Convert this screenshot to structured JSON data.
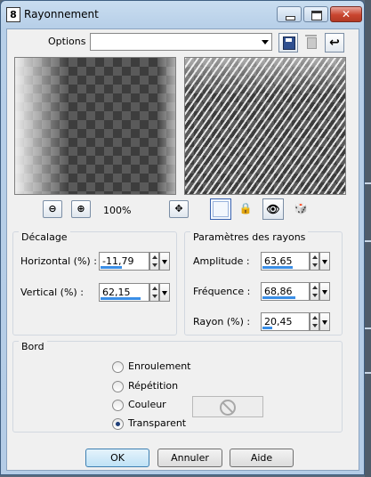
{
  "window": {
    "icon_text": "8",
    "title": "Rayonnement",
    "close_glyph": "✕"
  },
  "options": {
    "label": "Options :",
    "value": ""
  },
  "toolbar": {
    "reset_glyph": "↩"
  },
  "zoom": {
    "level": "100%",
    "out_glyph": "⊖",
    "in_glyph": "⊕",
    "pan_glyph": "✥"
  },
  "view_buttons": {
    "lock_glyph": "🔒",
    "eye_glyph": "👁",
    "random_glyph": "🎲"
  },
  "offset_group": {
    "title": "Décalage",
    "horizontal": {
      "label": "Horizontal (%) :",
      "value": "-11,79",
      "fill": 0.44
    },
    "vertical": {
      "label": "Vertical (%) :",
      "value": "62,15",
      "fill": 0.81
    }
  },
  "params_group": {
    "title": "Paramètres des rayons",
    "amplitude": {
      "label": "Amplitude :",
      "value": "63,65",
      "fill": 0.64
    },
    "frequency": {
      "label": "Fréquence :",
      "value": "68,86",
      "fill": 0.69
    },
    "radius": {
      "label": "Rayon (%) :",
      "value": "20,45",
      "fill": 0.2
    }
  },
  "edge_group": {
    "title": "Bord",
    "options": [
      {
        "label": "Enroulement",
        "checked": false
      },
      {
        "label": "Répétition",
        "checked": false
      },
      {
        "label": "Couleur",
        "checked": false
      },
      {
        "label": "Transparent",
        "checked": true
      }
    ]
  },
  "buttons": {
    "ok": "OK",
    "cancel": "Annuler",
    "help": "Aide"
  }
}
